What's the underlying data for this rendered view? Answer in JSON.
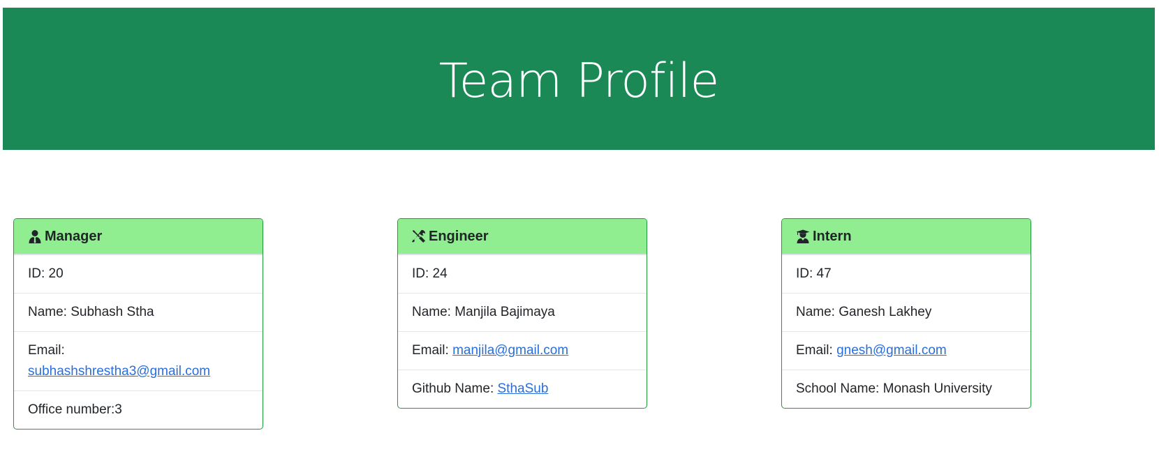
{
  "header": {
    "title": "Team Profile"
  },
  "colors": {
    "header_bg": "#1a8956",
    "card_header_bg": "#90ee90",
    "card_border": "#1f9a3a",
    "link": "#2a6edb"
  },
  "cards": [
    {
      "role": "Manager",
      "icon": "user-tie-icon",
      "id_label": "ID: 20",
      "name_label": "Name: Subhash Stha",
      "email_prefix": "Email: ",
      "email": "subhashshrestha3@gmail.com",
      "extra_label": "Office number:3"
    },
    {
      "role": "Engineer",
      "icon": "tools-icon",
      "id_label": "ID: 24",
      "name_label": "Name: Manjila Bajimaya",
      "email_prefix": "Email: ",
      "email": "manjila@gmail.com",
      "extra_prefix": "Github Name: ",
      "extra_link": "SthaSub"
    },
    {
      "role": "Intern",
      "icon": "user-graduate-icon",
      "id_label": "ID: 47",
      "name_label": "Name: Ganesh Lakhey",
      "email_prefix": "Email: ",
      "email": "gnesh@gmail.com",
      "extra_label": "School Name: Monash University"
    }
  ]
}
